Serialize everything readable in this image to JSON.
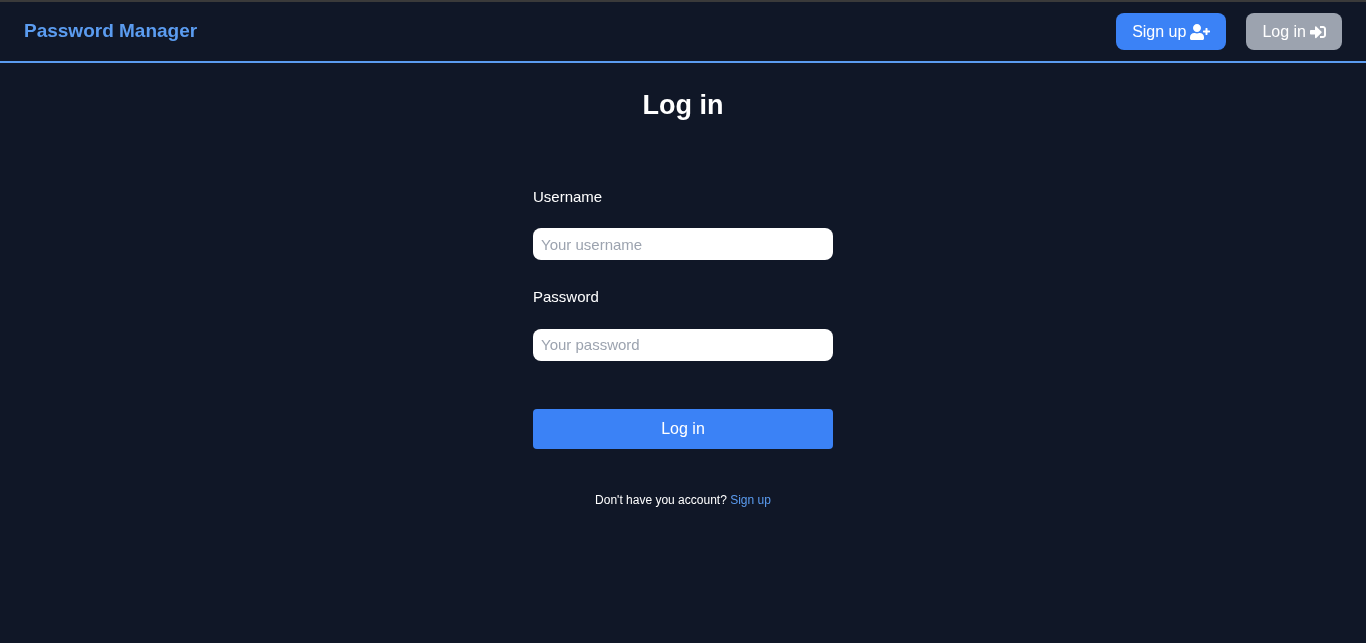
{
  "navbar": {
    "brand": "Password Manager",
    "buttons": [
      {
        "label": "Sign up",
        "kind": "signup",
        "selected": false
      },
      {
        "label": "Log in",
        "kind": "login",
        "selected": true
      }
    ]
  },
  "form": {
    "title": "Log in",
    "fields": [
      {
        "label": "Username",
        "placeholder": "Your username"
      },
      {
        "label": "Password",
        "placeholder": "Your password"
      }
    ],
    "submit": "Log in",
    "prompt": "Don't have you account?",
    "prompt_link": "Sign up"
  }
}
